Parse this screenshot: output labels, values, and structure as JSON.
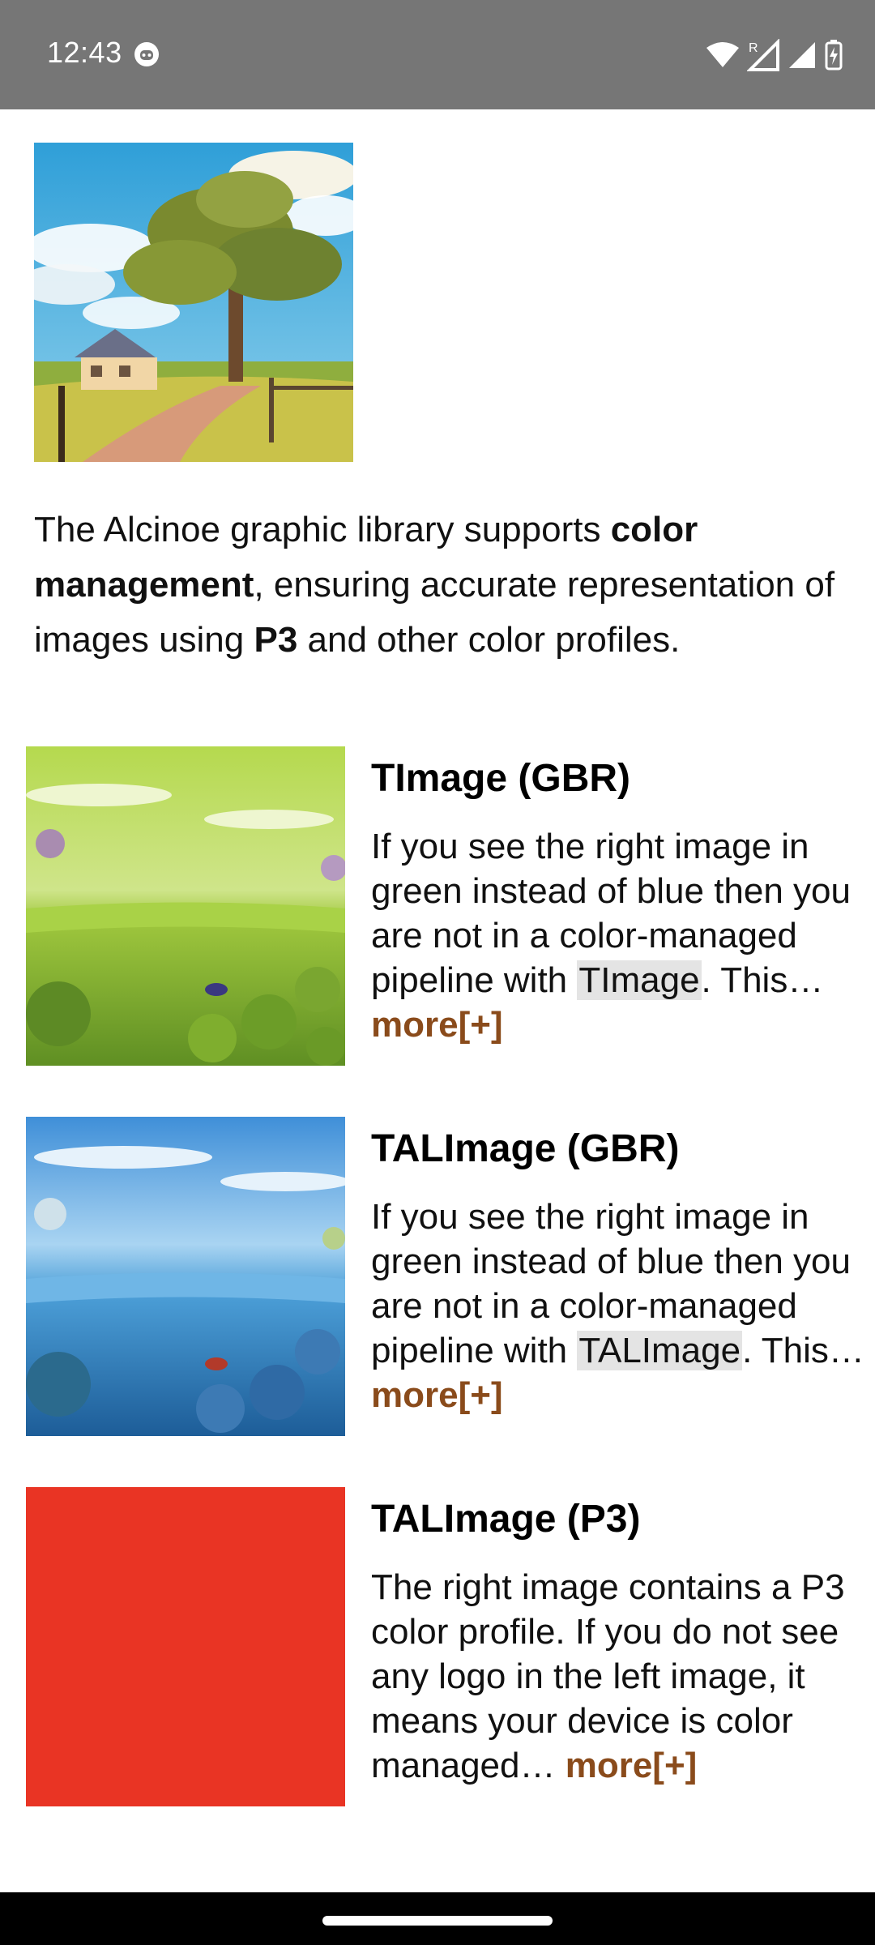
{
  "status_bar": {
    "time": "12:43",
    "notification_icon": "robot-face-icon",
    "icons": [
      "wifi-icon",
      "signal-roaming-icon",
      "signal-icon",
      "battery-charging-icon"
    ],
    "roaming_letter": "R"
  },
  "hero": {
    "image": "farmhouse-tree-illustration"
  },
  "intro": {
    "part1": "The Alcinoe graphic library supports ",
    "bold1": "color management",
    "part2": ", ensuring accurate representation of images using ",
    "bold2": "P3",
    "part3": " and other color profiles."
  },
  "cards": [
    {
      "title": "TImage (GBR)",
      "text_before": "If you see the right image in green instead of blue then you are not in a color-managed pipeline with ",
      "code": "TImage",
      "text_after": ". This… ",
      "more": "more[+]",
      "image": "green-underwater-scene"
    },
    {
      "title": "TALImage (GBR)",
      "text_before": "If you see the right image in green instead of blue then you are not in a color-managed pipeline with ",
      "code": "TALImage",
      "text_after": ". This… ",
      "more": "more[+]",
      "image": "blue-underwater-scene"
    },
    {
      "title": "TALImage (P3)",
      "text_before": "The right image contains a P3 color profile. If you do not see any logo in the left image, it means your device is color managed… ",
      "code": "",
      "text_after": "",
      "more": "more[+]",
      "image": "red-p3-square",
      "image_color": "#e93424"
    }
  ],
  "colors": {
    "status_bar": "#767676",
    "more_link": "#8a4b1b",
    "code_bg": "#e4e4e4",
    "nav_bar": "#000000"
  }
}
